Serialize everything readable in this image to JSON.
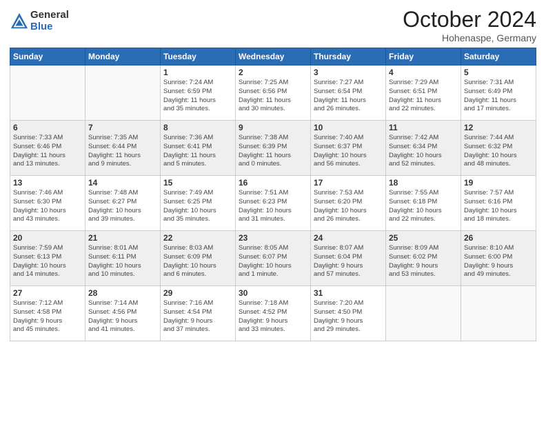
{
  "header": {
    "logo_general": "General",
    "logo_blue": "Blue",
    "month_title": "October 2024",
    "location": "Hohenaspe, Germany"
  },
  "weekdays": [
    "Sunday",
    "Monday",
    "Tuesday",
    "Wednesday",
    "Thursday",
    "Friday",
    "Saturday"
  ],
  "weeks": [
    [
      {
        "day": "",
        "info": ""
      },
      {
        "day": "",
        "info": ""
      },
      {
        "day": "1",
        "info": "Sunrise: 7:24 AM\nSunset: 6:59 PM\nDaylight: 11 hours\nand 35 minutes."
      },
      {
        "day": "2",
        "info": "Sunrise: 7:25 AM\nSunset: 6:56 PM\nDaylight: 11 hours\nand 30 minutes."
      },
      {
        "day": "3",
        "info": "Sunrise: 7:27 AM\nSunset: 6:54 PM\nDaylight: 11 hours\nand 26 minutes."
      },
      {
        "day": "4",
        "info": "Sunrise: 7:29 AM\nSunset: 6:51 PM\nDaylight: 11 hours\nand 22 minutes."
      },
      {
        "day": "5",
        "info": "Sunrise: 7:31 AM\nSunset: 6:49 PM\nDaylight: 11 hours\nand 17 minutes."
      }
    ],
    [
      {
        "day": "6",
        "info": "Sunrise: 7:33 AM\nSunset: 6:46 PM\nDaylight: 11 hours\nand 13 minutes."
      },
      {
        "day": "7",
        "info": "Sunrise: 7:35 AM\nSunset: 6:44 PM\nDaylight: 11 hours\nand 9 minutes."
      },
      {
        "day": "8",
        "info": "Sunrise: 7:36 AM\nSunset: 6:41 PM\nDaylight: 11 hours\nand 5 minutes."
      },
      {
        "day": "9",
        "info": "Sunrise: 7:38 AM\nSunset: 6:39 PM\nDaylight: 11 hours\nand 0 minutes."
      },
      {
        "day": "10",
        "info": "Sunrise: 7:40 AM\nSunset: 6:37 PM\nDaylight: 10 hours\nand 56 minutes."
      },
      {
        "day": "11",
        "info": "Sunrise: 7:42 AM\nSunset: 6:34 PM\nDaylight: 10 hours\nand 52 minutes."
      },
      {
        "day": "12",
        "info": "Sunrise: 7:44 AM\nSunset: 6:32 PM\nDaylight: 10 hours\nand 48 minutes."
      }
    ],
    [
      {
        "day": "13",
        "info": "Sunrise: 7:46 AM\nSunset: 6:30 PM\nDaylight: 10 hours\nand 43 minutes."
      },
      {
        "day": "14",
        "info": "Sunrise: 7:48 AM\nSunset: 6:27 PM\nDaylight: 10 hours\nand 39 minutes."
      },
      {
        "day": "15",
        "info": "Sunrise: 7:49 AM\nSunset: 6:25 PM\nDaylight: 10 hours\nand 35 minutes."
      },
      {
        "day": "16",
        "info": "Sunrise: 7:51 AM\nSunset: 6:23 PM\nDaylight: 10 hours\nand 31 minutes."
      },
      {
        "day": "17",
        "info": "Sunrise: 7:53 AM\nSunset: 6:20 PM\nDaylight: 10 hours\nand 26 minutes."
      },
      {
        "day": "18",
        "info": "Sunrise: 7:55 AM\nSunset: 6:18 PM\nDaylight: 10 hours\nand 22 minutes."
      },
      {
        "day": "19",
        "info": "Sunrise: 7:57 AM\nSunset: 6:16 PM\nDaylight: 10 hours\nand 18 minutes."
      }
    ],
    [
      {
        "day": "20",
        "info": "Sunrise: 7:59 AM\nSunset: 6:13 PM\nDaylight: 10 hours\nand 14 minutes."
      },
      {
        "day": "21",
        "info": "Sunrise: 8:01 AM\nSunset: 6:11 PM\nDaylight: 10 hours\nand 10 minutes."
      },
      {
        "day": "22",
        "info": "Sunrise: 8:03 AM\nSunset: 6:09 PM\nDaylight: 10 hours\nand 6 minutes."
      },
      {
        "day": "23",
        "info": "Sunrise: 8:05 AM\nSunset: 6:07 PM\nDaylight: 10 hours\nand 1 minute."
      },
      {
        "day": "24",
        "info": "Sunrise: 8:07 AM\nSunset: 6:04 PM\nDaylight: 9 hours\nand 57 minutes."
      },
      {
        "day": "25",
        "info": "Sunrise: 8:09 AM\nSunset: 6:02 PM\nDaylight: 9 hours\nand 53 minutes."
      },
      {
        "day": "26",
        "info": "Sunrise: 8:10 AM\nSunset: 6:00 PM\nDaylight: 9 hours\nand 49 minutes."
      }
    ],
    [
      {
        "day": "27",
        "info": "Sunrise: 7:12 AM\nSunset: 4:58 PM\nDaylight: 9 hours\nand 45 minutes."
      },
      {
        "day": "28",
        "info": "Sunrise: 7:14 AM\nSunset: 4:56 PM\nDaylight: 9 hours\nand 41 minutes."
      },
      {
        "day": "29",
        "info": "Sunrise: 7:16 AM\nSunset: 4:54 PM\nDaylight: 9 hours\nand 37 minutes."
      },
      {
        "day": "30",
        "info": "Sunrise: 7:18 AM\nSunset: 4:52 PM\nDaylight: 9 hours\nand 33 minutes."
      },
      {
        "day": "31",
        "info": "Sunrise: 7:20 AM\nSunset: 4:50 PM\nDaylight: 9 hours\nand 29 minutes."
      },
      {
        "day": "",
        "info": ""
      },
      {
        "day": "",
        "info": ""
      }
    ]
  ]
}
